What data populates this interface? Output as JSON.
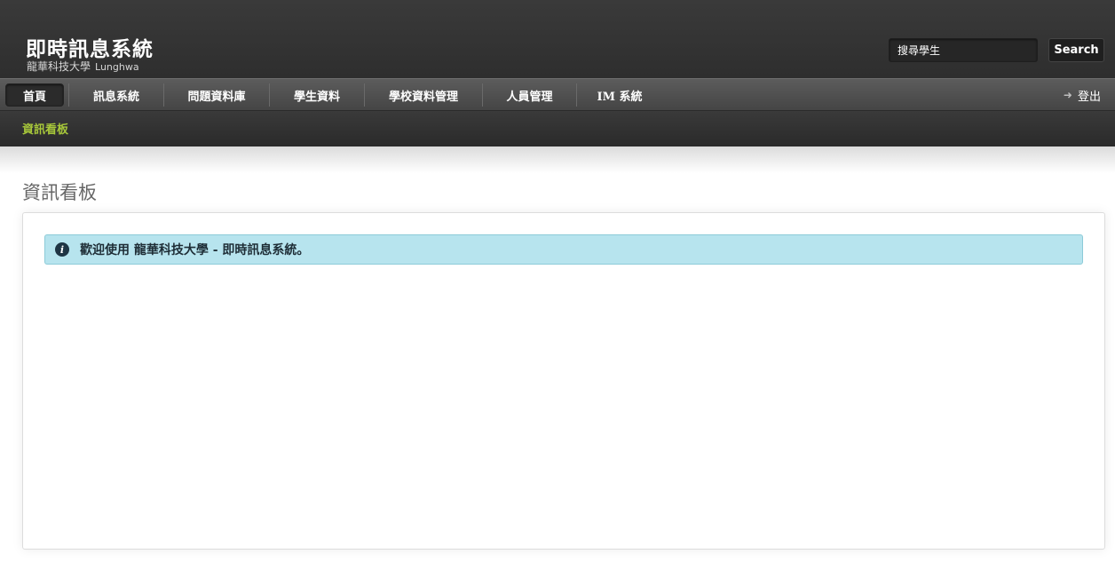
{
  "header": {
    "title": "即時訊息系統",
    "subtitle": "龍華科技大學",
    "subtitle_latin": "Lunghwa",
    "search_placeholder": "搜尋學生",
    "search_button": "Search"
  },
  "nav": {
    "items": [
      {
        "label": "首頁",
        "active": true
      },
      {
        "label": "訊息系統"
      },
      {
        "label": "問題資料庫"
      },
      {
        "label": "學生資料"
      },
      {
        "label": "學校資料管理"
      },
      {
        "label": "人員管理"
      },
      {
        "label": "IM 系統"
      }
    ],
    "logout": "登出",
    "logout_icon": "arrow-right-icon"
  },
  "subnav": {
    "items": [
      {
        "label": "資訊看板",
        "active": true
      }
    ],
    "active_color": "#a8c83a"
  },
  "main": {
    "page_title": "資訊看板",
    "alert": {
      "icon": "info-icon",
      "text": "歡迎使用 龍華科技大學 - 即時訊息系統。"
    }
  }
}
